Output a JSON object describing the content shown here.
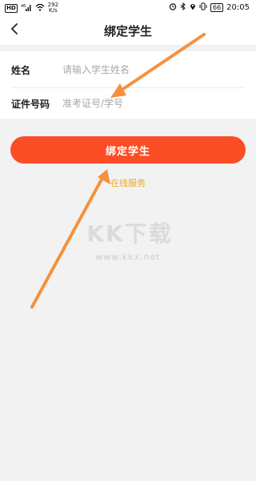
{
  "status_bar": {
    "hd": "HD",
    "signal": "46",
    "net_speed_value": "292",
    "net_speed_unit": "K/s",
    "battery": "66",
    "time": "20:05"
  },
  "header": {
    "title": "绑定学生"
  },
  "form": {
    "name_label": "姓名",
    "name_placeholder": "请输入学生姓名",
    "id_label": "证件号码",
    "id_placeholder": "准考证号/学号"
  },
  "actions": {
    "bind_label": "绑定学生",
    "online_service": "在线服务"
  },
  "watermark": {
    "logo": "KK下载",
    "url": "www.kkx.net"
  },
  "colors": {
    "accent": "#fb4d26",
    "link": "#e9a82a",
    "annotation_arrow": "#f5913e",
    "background": "#f2f2f2"
  }
}
